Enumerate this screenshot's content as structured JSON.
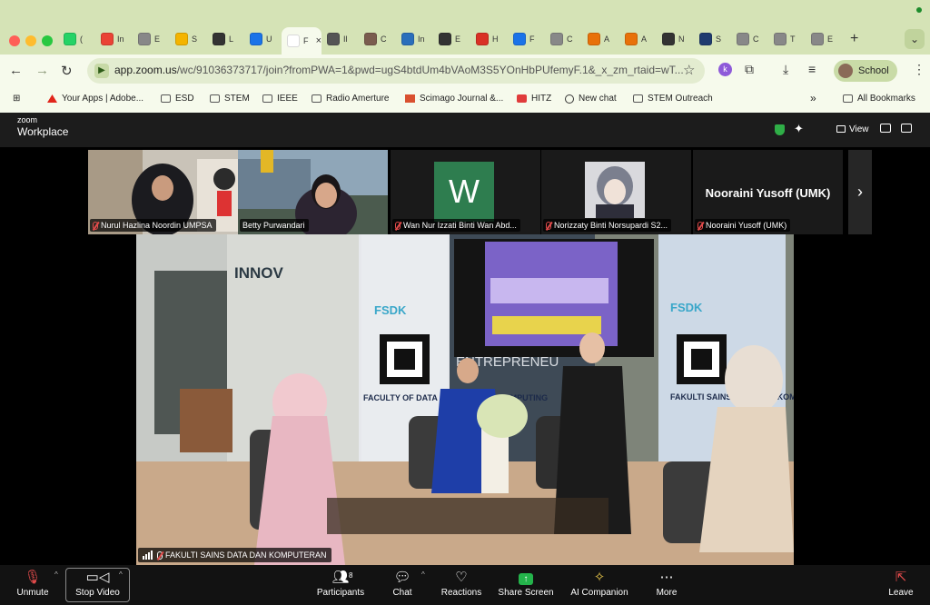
{
  "browser": {
    "tabs": [
      {
        "label": "(",
        "color": "#25d366"
      },
      {
        "label": "In",
        "color": "#ea4335"
      },
      {
        "label": "E",
        "color": "#888888"
      },
      {
        "label": "S",
        "color": "#f4b400"
      },
      {
        "label": "L",
        "color": "#333333"
      },
      {
        "label": "U",
        "color": "#1a73e8"
      },
      {
        "label": "F",
        "color": "#f6faec",
        "active": true
      },
      {
        "label": "Il",
        "color": "#555555"
      },
      {
        "label": "C",
        "color": "#7a5c4e"
      },
      {
        "label": "In",
        "color": "#2a6ebb"
      },
      {
        "label": "E",
        "color": "#333333"
      },
      {
        "label": "H",
        "color": "#d93025"
      },
      {
        "label": "F",
        "color": "#1a73e8"
      },
      {
        "label": "C",
        "color": "#888888"
      },
      {
        "label": "A",
        "color": "#e8710a"
      },
      {
        "label": "A",
        "color": "#e8710a"
      },
      {
        "label": "N",
        "color": "#333333"
      },
      {
        "label": "S",
        "color": "#1f3b6f"
      },
      {
        "label": "C",
        "color": "#888888"
      },
      {
        "label": "T",
        "color": "#888888"
      },
      {
        "label": "E",
        "color": "#888888"
      }
    ],
    "active_tab_close": "×",
    "new_tab": "+",
    "tab_menu": "⌄",
    "url_main": "app.zoom.us",
    "url_rest": "/wc/91036373717/join?fromPWA=1&pwd=ugS4btdUm4bVAoM3S5YOnHbPUfemyF.1&_x_zm_rtaid=wT...",
    "profile_name": "School",
    "ext_badge": "k",
    "bookmarks": [
      {
        "label": "Your Apps | Adobe...",
        "icon": "adobe-icon"
      },
      {
        "label": "ESD",
        "icon": "folder-icon"
      },
      {
        "label": "STEM",
        "icon": "folder-icon"
      },
      {
        "label": "IEEE",
        "icon": "folder-icon"
      },
      {
        "label": "Radio Amerture",
        "icon": "folder-icon"
      },
      {
        "label": "Scimago Journal &...",
        "icon": "sjr-icon"
      },
      {
        "label": "HITZ",
        "icon": "hitz-icon"
      },
      {
        "label": "New chat",
        "icon": "openai-icon"
      },
      {
        "label": "STEM Outreach",
        "icon": "folder-icon"
      }
    ],
    "all_bookmarks": "All Bookmarks",
    "more_bookmarks": "»"
  },
  "zoom": {
    "logo_top": "zoom",
    "logo_bottom": "Workplace",
    "view_label": "View",
    "participants_strip": [
      {
        "name": "Nurul Hazlina Noordin UMPSA",
        "muted": true,
        "kind": "video"
      },
      {
        "name": "Betty Purwandari",
        "muted": false,
        "kind": "video"
      },
      {
        "name": "Wan Nur Izzati Binti Wan Abd...",
        "muted": true,
        "kind": "avatar",
        "avatar_letter": "W",
        "avatar_color": "#2e7d4f"
      },
      {
        "name": "Norizzaty Binti Norsupardi S2...",
        "muted": true,
        "kind": "image"
      },
      {
        "name": "Nooraini Yusoff (UMK)",
        "muted": true,
        "kind": "name",
        "display_name": "Nooraini Yusoff (UMK)"
      }
    ],
    "main_speaker": "FAKULTI SAINS DATA DAN KOMPUTERAN",
    "stage_text": {
      "innov": "INNOV",
      "fsdk": "FSDK",
      "faculty_left": "FACULTY OF DATA SCIENCE AND COMPUTING",
      "faculty_right": "FAKULTI SAINS DATA DAN KOMPUTERAN",
      "entrepreneur": "ENTREPRENEU"
    },
    "controls": [
      {
        "label": "Unmute",
        "icon": "mic-muted-icon"
      },
      {
        "label": "Stop Video",
        "icon": "video-icon"
      },
      {
        "label": "Participants",
        "icon": "participants-icon",
        "count": "8"
      },
      {
        "label": "Chat",
        "icon": "chat-icon"
      },
      {
        "label": "Reactions",
        "icon": "heart-icon"
      },
      {
        "label": "Share Screen",
        "icon": "share-screen-icon"
      },
      {
        "label": "AI Companion",
        "icon": "ai-sparkle-icon"
      },
      {
        "label": "More",
        "icon": "more-icon"
      },
      {
        "label": "Leave",
        "icon": "leave-icon"
      }
    ]
  }
}
